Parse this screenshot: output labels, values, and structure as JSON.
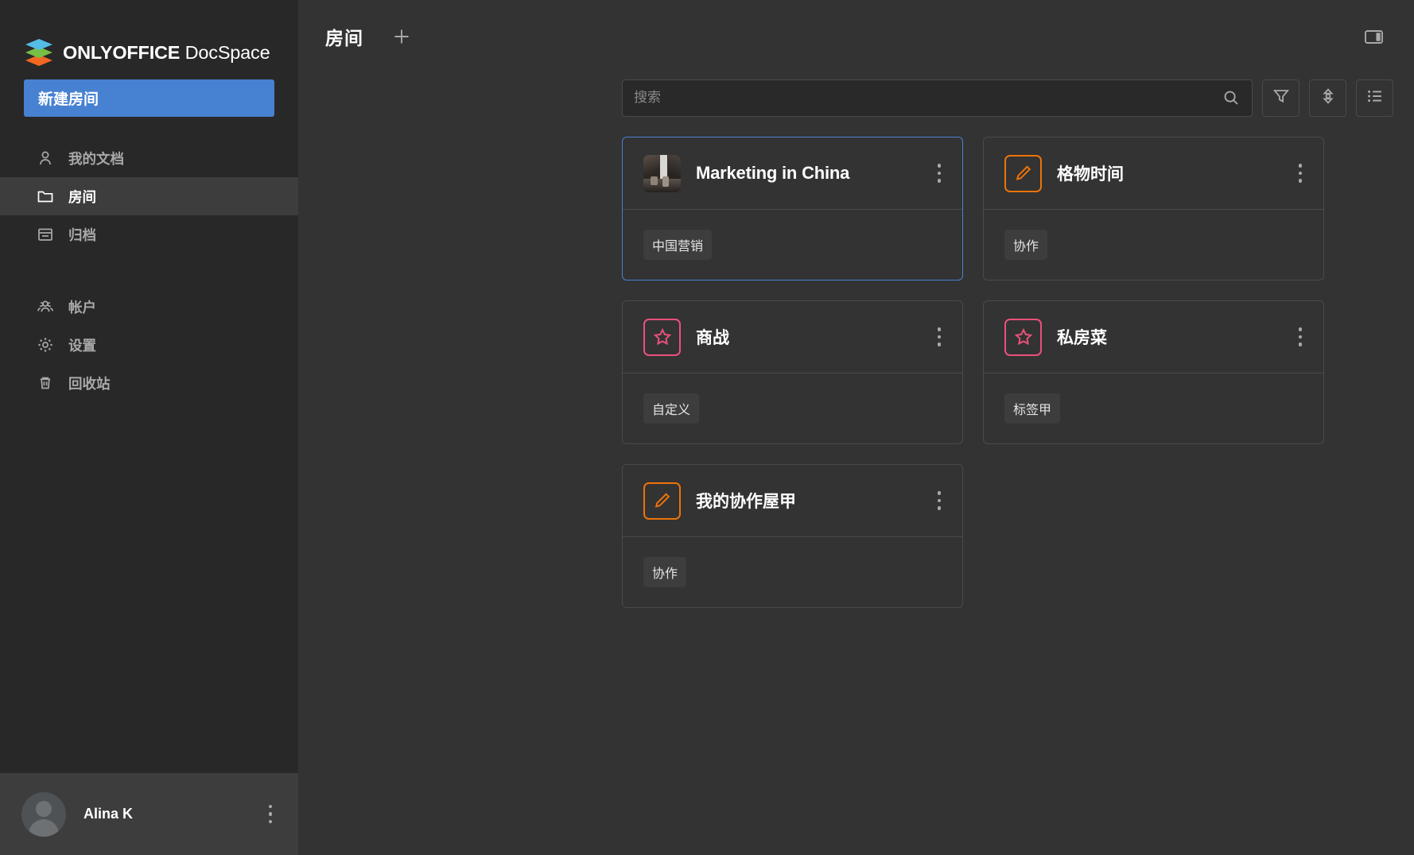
{
  "brand": {
    "name_bold": "ONLYOFFICE",
    "name_light": " DocSpace",
    "logo_icon": "onlyoffice-stack-logo",
    "logo_colors": [
      "#55bce6",
      "#77bf46",
      "#f26722"
    ]
  },
  "sidebar": {
    "new_room_button": "新建房间",
    "items": [
      {
        "label": "我的文档",
        "icon": "person-icon",
        "selected": false
      },
      {
        "label": "房间",
        "icon": "folder-icon",
        "selected": true
      },
      {
        "label": "归档",
        "icon": "archive-box-icon",
        "selected": false
      },
      {
        "label": "帐户",
        "icon": "people-group-icon",
        "selected": false
      },
      {
        "label": "设置",
        "icon": "gear-icon",
        "selected": false
      },
      {
        "label": "回收站",
        "icon": "trash-icon",
        "selected": false
      }
    ],
    "profile": {
      "name": "Alina K",
      "avatar_icon": "default-user-avatar-icon",
      "menu_icon": "kebab-menu-icon"
    }
  },
  "header": {
    "title": "房间",
    "add_icon": "plus-icon",
    "panel_toggle_icon": "panel-layout-toggle-icon"
  },
  "search": {
    "value": "",
    "placeholder": "搜索",
    "search_icon": "search-icon"
  },
  "toolbar": {
    "filter_icon": "funnel-filter-icon",
    "sort_icon": "sort-updown-icon",
    "view_icon": "list-view-icon"
  },
  "colors": {
    "accent": "#4781d1",
    "sidebar_bg": "#282828",
    "main_bg": "#333333",
    "border": "#4a4a4a",
    "orange": "#ed7309",
    "pink": "#eb507c",
    "text": "#ffffff",
    "muted_text": "#a9a9a9"
  },
  "rooms": [
    {
      "title": "Marketing in China",
      "title_script": "latin",
      "icon": "room-photo-thumbnail",
      "icon_style": "photo",
      "tag": "中国营销",
      "selected": true,
      "menu_icon": "kebab-menu-icon"
    },
    {
      "title": "格物时间",
      "title_script": "cjk",
      "icon": "pencil-edit-icon",
      "icon_style": "outline-orange",
      "tag": "协作",
      "selected": false,
      "menu_icon": "kebab-menu-icon"
    },
    {
      "title": "商战",
      "title_script": "cjk",
      "icon": "star-outline-icon",
      "icon_style": "outline-pink",
      "tag": "自定义",
      "selected": false,
      "menu_icon": "kebab-menu-icon"
    },
    {
      "title": "私房菜",
      "title_script": "cjk",
      "icon": "star-outline-icon",
      "icon_style": "outline-pink",
      "tag": "标签甲",
      "selected": false,
      "menu_icon": "kebab-menu-icon"
    },
    {
      "title": "我的协作屋甲",
      "title_script": "cjk",
      "icon": "pencil-edit-icon",
      "icon_style": "outline-orange",
      "tag": "协作",
      "selected": false,
      "menu_icon": "kebab-menu-icon"
    }
  ]
}
